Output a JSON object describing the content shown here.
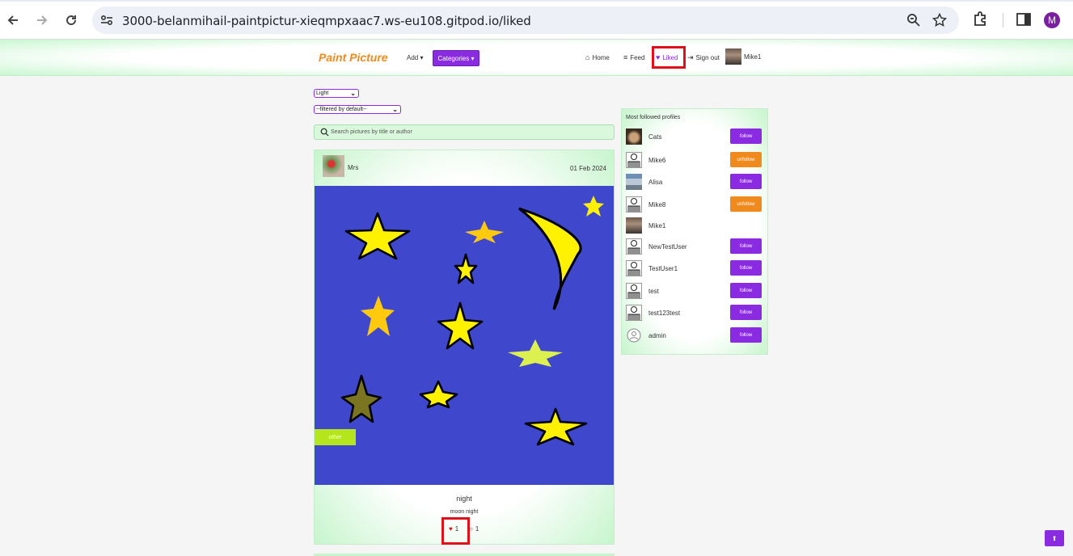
{
  "browser": {
    "url": "3000-belanmihail-paintpictur-xieqmpxaac7.ws-eu108.gitpod.io/liked",
    "profile_initial": "M"
  },
  "header": {
    "brand": "Paint Picture",
    "add_label": "Add",
    "categories_label": "Categories",
    "nav": {
      "home": "Home",
      "feed": "Feed",
      "liked": "Liked",
      "sign_out": "Sign out",
      "user": "Mike1"
    }
  },
  "filters": {
    "theme": "Light",
    "filter": "--filtered by default--",
    "search_placeholder": "Search pictures by title or author"
  },
  "post": {
    "author": "Mrs",
    "date": "01 Feb 2024",
    "category": "other",
    "title": "night",
    "description": "moon night",
    "likes": "1",
    "comments": "1"
  },
  "sidebar": {
    "title": "Most followed profiles",
    "profiles": [
      {
        "name": "Cats",
        "action": "follow"
      },
      {
        "name": "Mike6",
        "action": "unfollow"
      },
      {
        "name": "Alisa",
        "action": "follow"
      },
      {
        "name": "Mike8",
        "action": "unfollow"
      },
      {
        "name": "Mike1",
        "action": ""
      },
      {
        "name": "NewTestUser",
        "action": "follow"
      },
      {
        "name": "TestUser1",
        "action": "follow"
      },
      {
        "name": "test",
        "action": "follow"
      },
      {
        "name": "test123test",
        "action": "follow"
      },
      {
        "name": "admin",
        "action": "follow"
      }
    ]
  },
  "colors": {
    "accent": "#8a2be2",
    "brand": "#f08a1c",
    "highlight": "#e0101a",
    "canvas": "#3f48cc",
    "category": "#b5e61d"
  }
}
